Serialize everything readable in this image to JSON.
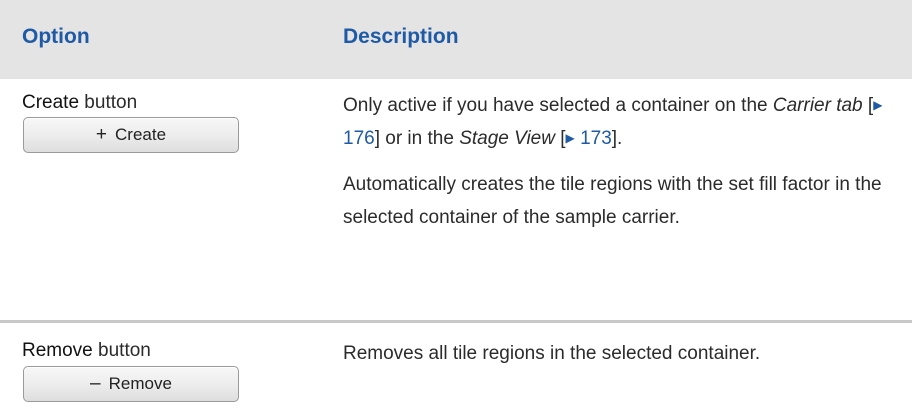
{
  "header": {
    "option": "Option",
    "description": "Description"
  },
  "rows": [
    {
      "name": "Create",
      "suffix": " button",
      "button": {
        "glyph": "+",
        "label": "Create"
      },
      "desc1": {
        "pre": "Only active if you have selected a container on the ",
        "ref1_text": "Carrier tab",
        "ref1_page": "176",
        "mid": " or in the ",
        "ref2_text": "Stage View",
        "ref2_page": "173",
        "post": "."
      },
      "desc2": "Automatically creates the tile regions with the set fill factor in the selected container of the sample carrier."
    },
    {
      "name": "Remove",
      "suffix": " button",
      "button": {
        "glyph": "–",
        "label": "Remove"
      },
      "desc1": "Removes all tile regions in the selected container."
    }
  ],
  "icons": {
    "xref_arrow": "triangle-right-icon",
    "add": "plus-icon",
    "remove": "minus-icon"
  },
  "colors": {
    "accent": "#1f5aa6",
    "header_bg": "#e4e4e4",
    "divider": "#c8c8c8"
  }
}
